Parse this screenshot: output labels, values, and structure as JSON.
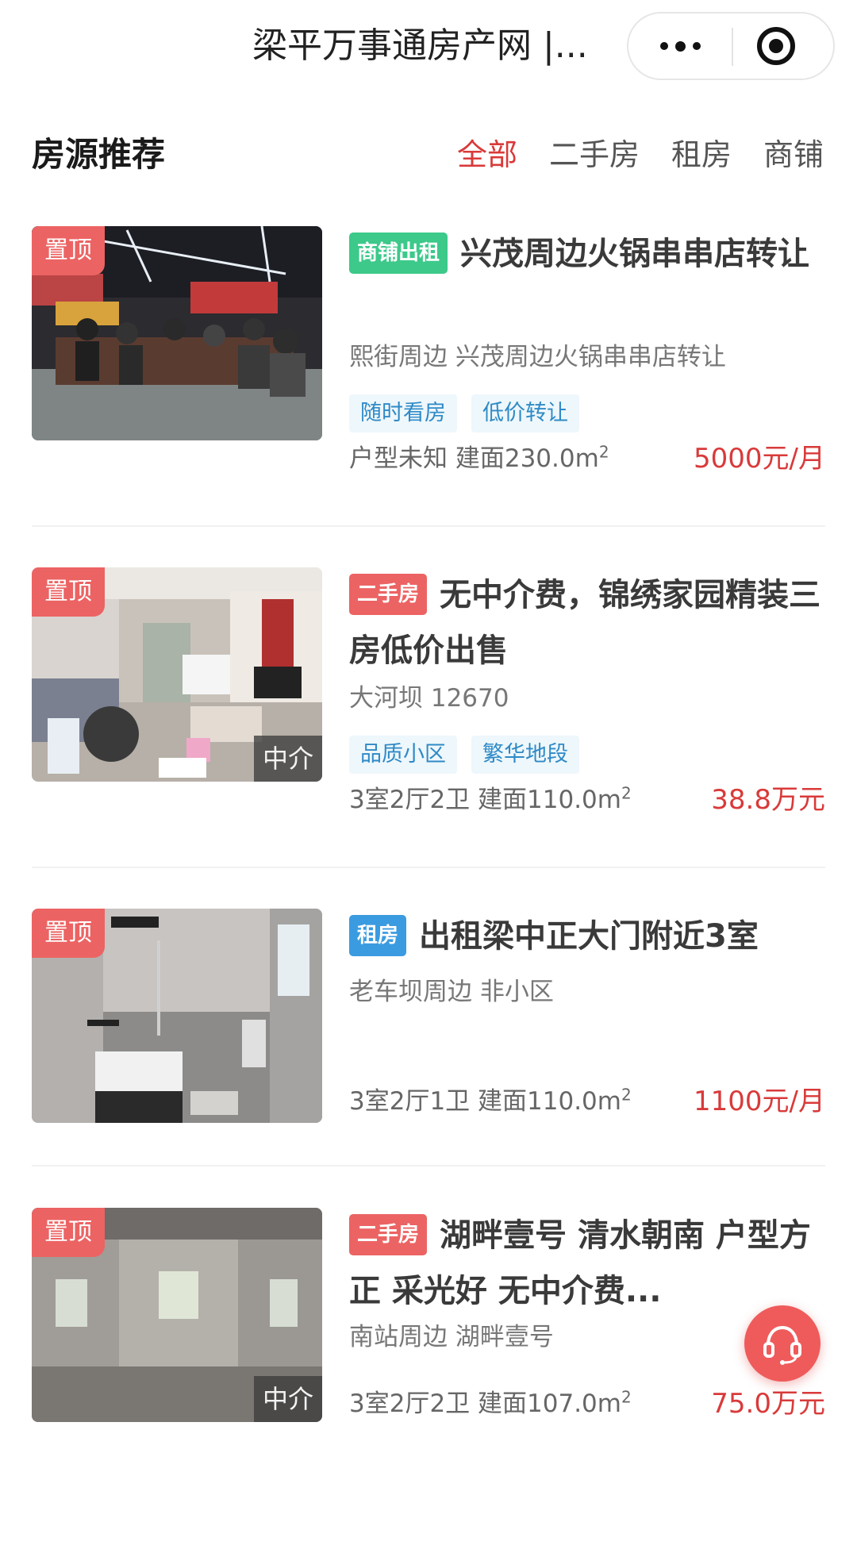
{
  "app_title": "梁平万事通房产网 |...",
  "capsule": {
    "more_icon": "more-dots-icon",
    "close_icon": "close-target-icon"
  },
  "section": {
    "title": "房源推荐",
    "tabs": [
      {
        "label": "全部",
        "active": true
      },
      {
        "label": "二手房",
        "active": false
      },
      {
        "label": "租房",
        "active": false
      },
      {
        "label": "商铺",
        "active": false
      }
    ]
  },
  "listings": [
    {
      "pin_label": "置顶",
      "category": "商铺出租",
      "category_color": "#3cc98a",
      "title": "兴茂周边火锅串串店转让",
      "location": "熙街周边 兴茂周边火锅串串店转让",
      "tags": [
        "随时看房",
        "低价转让"
      ],
      "spec": "户型未知  建面230.0m",
      "spec_sup": "2",
      "price": "5000元/月",
      "agency_label": ""
    },
    {
      "pin_label": "置顶",
      "category": "二手房",
      "category_color": "#ec6363",
      "title": "无中介费，锦绣家园精装三房低价出售",
      "location": "大河坝 12670",
      "tags": [
        "品质小区",
        "繁华地段"
      ],
      "spec": "3室2厅2卫  建面110.0m",
      "spec_sup": "2",
      "price": "38.8万元",
      "agency_label": "中介"
    },
    {
      "pin_label": "置顶",
      "category": "租房",
      "category_color": "#3b9be0",
      "title": "出租梁中正大门附近3室",
      "location": "老车坝周边 非小区",
      "tags": [],
      "spec": "3室2厅1卫  建面110.0m",
      "spec_sup": "2",
      "price": "1100元/月",
      "agency_label": ""
    },
    {
      "pin_label": "置顶",
      "category": "二手房",
      "category_color": "#ec6363",
      "title": "湖畔壹号 清水朝南 户型方正 采光好 无中介费...",
      "location": "南站周边 湖畔壹号",
      "tags": [],
      "spec": "3室2厅2卫  建面107.0m",
      "spec_sup": "2",
      "price": "75.0万元",
      "agency_label": "中介"
    }
  ],
  "float_button": {
    "icon": "headset-icon"
  }
}
